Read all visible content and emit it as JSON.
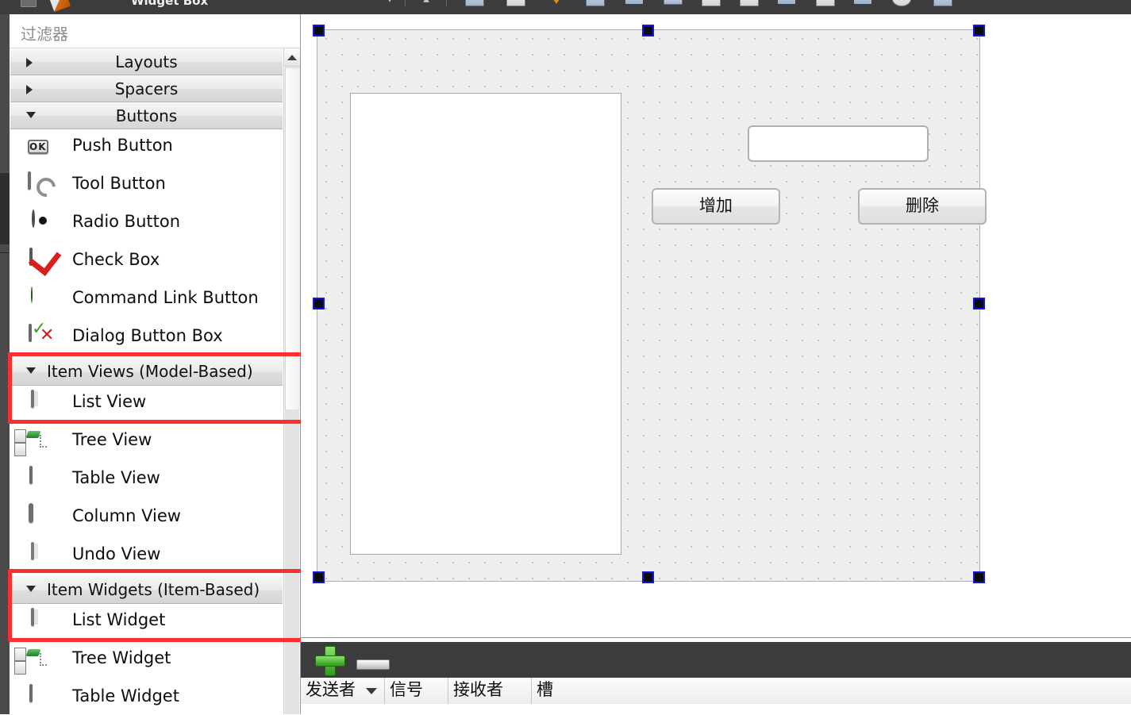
{
  "window": {
    "panel_title": "Widget Box",
    "pencil_icon": "pencil-icon",
    "square_icon": "square-icon"
  },
  "toolbar": {
    "icons": [
      "chevron-down-icon",
      "chevron-up-icon",
      "edit-widgets-icon",
      "edit-signals-slots-icon",
      "edit-buddies-icon",
      "edit-tab-order-icon",
      "layout-horizontally-icon",
      "layout-vertically-icon",
      "layout-grid-icon",
      "layout-form-icon",
      "layout-splitter-h-icon",
      "layout-splitter-v-icon",
      "break-layout-icon",
      "adjust-size-icon",
      "preview-icon"
    ]
  },
  "widget_box": {
    "filter": {
      "placeholder": "过滤器",
      "value": ""
    },
    "groups": [
      {
        "label": "Layouts",
        "expanded": false,
        "icon": "chevron-right-icon",
        "items": []
      },
      {
        "label": "Spacers",
        "expanded": false,
        "icon": "chevron-right-icon",
        "items": []
      },
      {
        "label": "Buttons",
        "expanded": true,
        "icon": "chevron-down-icon",
        "items": [
          {
            "label": "Push Button",
            "icon": "push-button-icon"
          },
          {
            "label": "Tool Button",
            "icon": "tool-button-icon"
          },
          {
            "label": "Radio Button",
            "icon": "radio-button-icon"
          },
          {
            "label": "Check Box",
            "icon": "check-box-icon"
          },
          {
            "label": "Command Link Button",
            "icon": "command-link-button-icon"
          },
          {
            "label": "Dialog Button Box",
            "icon": "dialog-button-box-icon"
          }
        ]
      },
      {
        "label": "Item Views (Model-Based)",
        "expanded": true,
        "icon": "chevron-down-icon",
        "highlighted": true,
        "items": [
          {
            "label": "List View",
            "icon": "list-view-icon",
            "highlighted": true
          },
          {
            "label": "Tree View",
            "icon": "tree-view-icon"
          },
          {
            "label": "Table View",
            "icon": "table-view-icon"
          },
          {
            "label": "Column View",
            "icon": "column-view-icon"
          },
          {
            "label": "Undo View",
            "icon": "undo-view-icon"
          }
        ]
      },
      {
        "label": "Item Widgets (Item-Based)",
        "expanded": true,
        "icon": "chevron-down-icon",
        "highlighted": true,
        "items": [
          {
            "label": "List Widget",
            "icon": "list-widget-icon",
            "highlighted": true
          },
          {
            "label": "Tree Widget",
            "icon": "tree-widget-icon"
          },
          {
            "label": "Table Widget",
            "icon": "table-widget-icon"
          }
        ]
      }
    ],
    "scrollbar": {
      "up_arrow": "scroll-up-arrow-icon"
    }
  },
  "designer": {
    "form_widgets": {
      "list_view": {
        "type": "QListView",
        "text": ""
      },
      "line_edit": {
        "type": "QLineEdit",
        "text": "",
        "placeholder": ""
      },
      "buttons": [
        {
          "label": "增加"
        },
        {
          "label": "删除"
        }
      ]
    },
    "selection_handles": 8
  },
  "signal_slot_editor": {
    "add_button": "add-connection-icon",
    "remove_button": "remove-connection-icon",
    "columns": [
      {
        "label": "发送者",
        "sorted": true
      },
      {
        "label": "信号",
        "sorted": false
      },
      {
        "label": "接收者",
        "sorted": false
      },
      {
        "label": "槽",
        "sorted": false
      }
    ],
    "rows": []
  },
  "colors": {
    "chrome_dark": "#3c3c3c",
    "panel_bg": "#ffffff",
    "canvas_bg": "#efefef",
    "grid_dot": "#bcbcbc",
    "highlight_red": "#fb2f2f",
    "handle_blue": "#1414e6",
    "group_header": "#e4e4e4"
  }
}
